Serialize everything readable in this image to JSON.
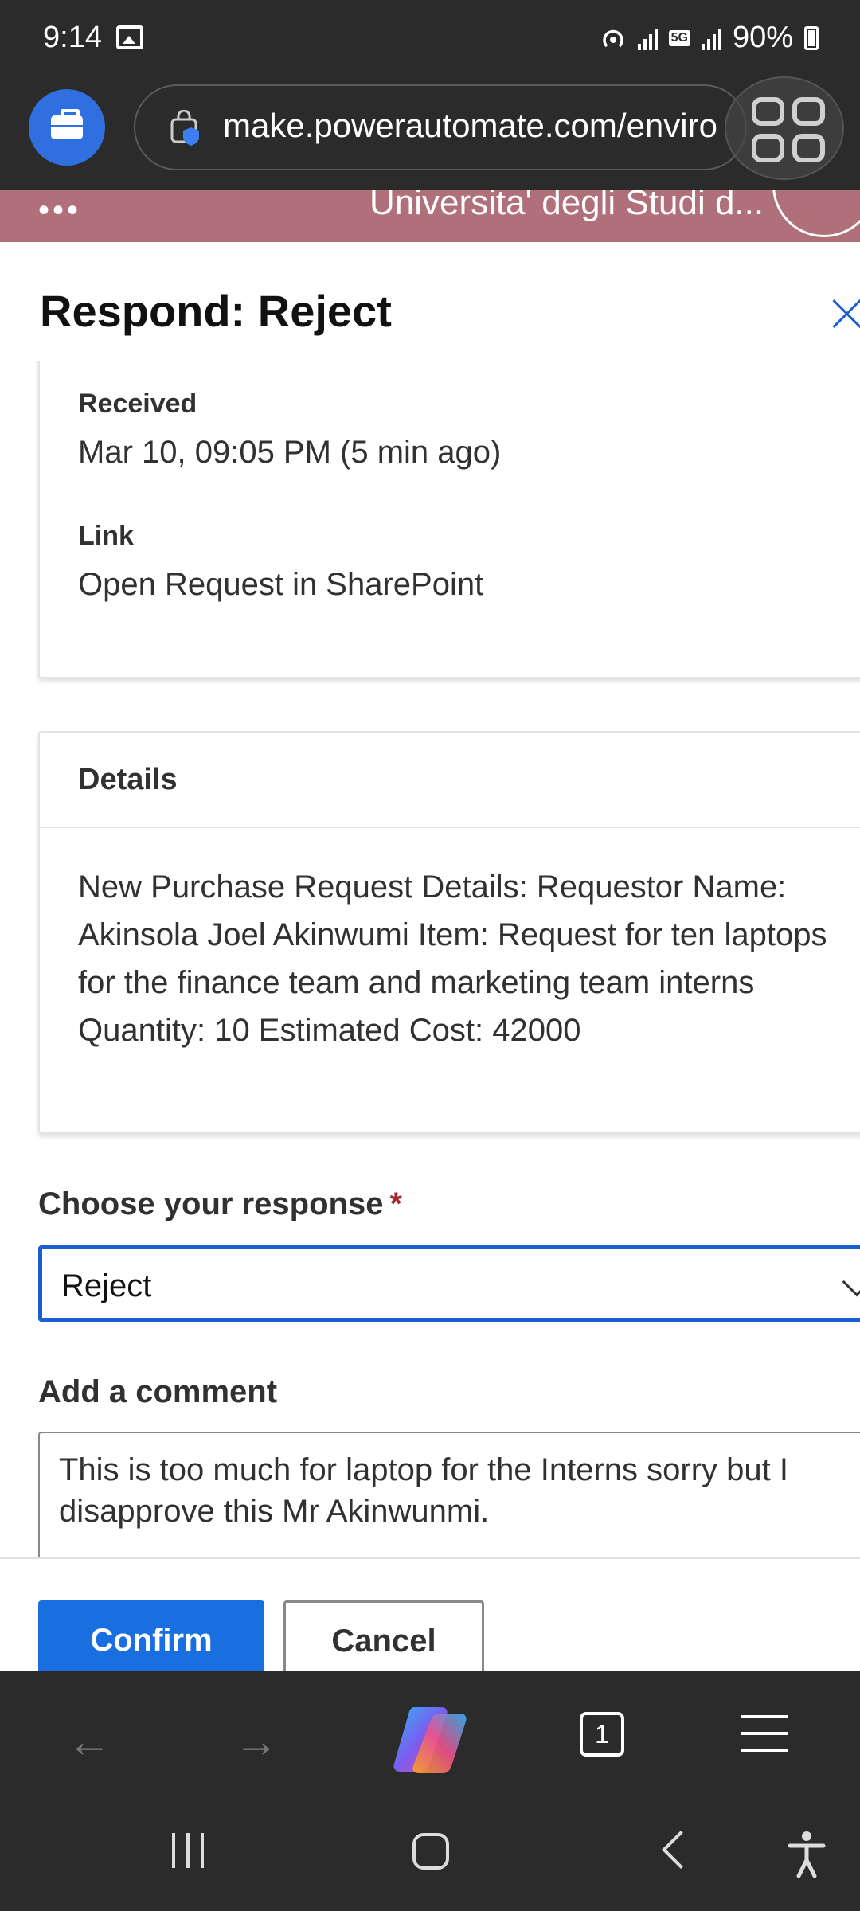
{
  "status_bar": {
    "time": "9:14",
    "network": "5G",
    "battery": "90%"
  },
  "browser": {
    "url": "make.powerautomate.com/enviro",
    "tab_count": "1"
  },
  "app_header": {
    "title": "Universita' degli Studi d...",
    "more": "•••"
  },
  "panel": {
    "title": "Respond: Reject",
    "received_label": "Received",
    "received_value": "Mar 10, 09:05 PM (5 min ago)",
    "link_label": "Link",
    "link_value": "Open Request in SharePoint",
    "details_header": "Details",
    "details_text": "New Purchase Request Details: Requestor Name: Akinsola Joel Akinwumi Item: Request for ten laptops for the finance team and marketing team interns Quantity: 10 Estimated Cost: 42000",
    "response_label": "Choose your response",
    "response_required": "*",
    "response_value": "Reject",
    "comment_label": "Add a comment",
    "comment_value": "This is too much for laptop for the Interns sorry but I disapprove this Mr Akinwunmi.",
    "confirm_label": "Confirm",
    "cancel_label": "Cancel"
  },
  "colors": {
    "accent": "#1a6fe0",
    "header": "#b0707a",
    "required": "#a4262c"
  },
  "icons": [
    "gallery-icon",
    "hotspot-icon",
    "signal-icon",
    "battery-icon",
    "briefcase-icon",
    "shield-icon",
    "overlay-icon",
    "close-icon",
    "chevron-down-icon",
    "back-arrow-icon",
    "forward-arrow-icon",
    "copilot-icon",
    "tabs-icon",
    "menu-icon",
    "recents-icon",
    "home-icon",
    "nav-back-icon",
    "accessibility-icon"
  ]
}
